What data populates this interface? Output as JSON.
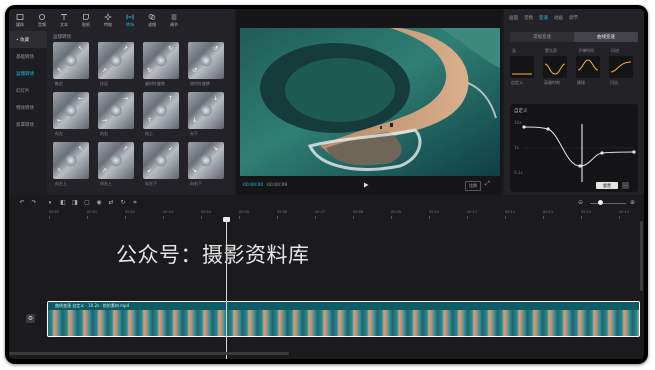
{
  "top_tabs": [
    {
      "label": "媒体",
      "icon": "media-icon"
    },
    {
      "label": "音频",
      "icon": "audio-icon"
    },
    {
      "label": "文本",
      "icon": "text-icon"
    },
    {
      "label": "贴纸",
      "icon": "sticker-icon"
    },
    {
      "label": "特效",
      "icon": "effects-icon"
    },
    {
      "label": "转场",
      "icon": "transition-icon"
    },
    {
      "label": "滤镜",
      "icon": "filter-icon"
    },
    {
      "label": "调节",
      "icon": "adjust-icon"
    }
  ],
  "active_tab_index": 5,
  "sidebar": {
    "items": [
      {
        "label": "• 收藏"
      },
      {
        "label": "基础转场"
      },
      {
        "label": "运镜转场"
      },
      {
        "label": "幻灯片"
      },
      {
        "label": "特效转场"
      },
      {
        "label": "遮罩转场"
      }
    ],
    "active_index": 2
  },
  "grid": {
    "title": "运镜转场",
    "items": [
      {
        "label": "推近"
      },
      {
        "label": "拉远"
      },
      {
        "label": "顺时针旋转"
      },
      {
        "label": "逆时针旋转"
      },
      {
        "label": "向左"
      },
      {
        "label": "向右"
      },
      {
        "label": "向上"
      },
      {
        "label": "向下"
      },
      {
        "label": "向左上"
      },
      {
        "label": "向右上"
      },
      {
        "label": "向左下"
      },
      {
        "label": "向右下"
      }
    ]
  },
  "preview": {
    "time_current": "00:00:00",
    "time_total": "00:00:09",
    "ratio_label": "比例"
  },
  "right_panel": {
    "tabs": [
      "画面",
      "音频",
      "变速",
      "动画",
      "调节"
    ],
    "active_tab": 2,
    "segments": [
      "常规变速",
      "曲线变速"
    ],
    "active_segment": 1,
    "presets": [
      {
        "caption": "无",
        "label": "自定义"
      },
      {
        "caption": "蒙太奇",
        "label": "英雄时刻"
      },
      {
        "caption": "子弹时间",
        "label": "跳接"
      },
      {
        "caption": "闪进",
        "label": "闪出"
      }
    ],
    "editor": {
      "title": "自定义",
      "y_labels": [
        "10x",
        "1x",
        "0.1x"
      ]
    },
    "apply_label": "重置"
  },
  "timeline": {
    "ruler_labels": [
      "00:00",
      "00:01",
      "00:02",
      "00:03",
      "00:04",
      "00:05",
      "00:06",
      "00:07",
      "00:08",
      "00:09",
      "00:10",
      "00:11",
      "00:12",
      "00:13",
      "00:14",
      "00:15"
    ],
    "watermark": "公众号：摄影资料库",
    "clip_label": "曲线变速 自定义 · 10.2s · 航拍素材.mp4"
  },
  "colors": {
    "accent": "#20c4d8",
    "panel": "#232327",
    "background": "#1b1b1e"
  }
}
